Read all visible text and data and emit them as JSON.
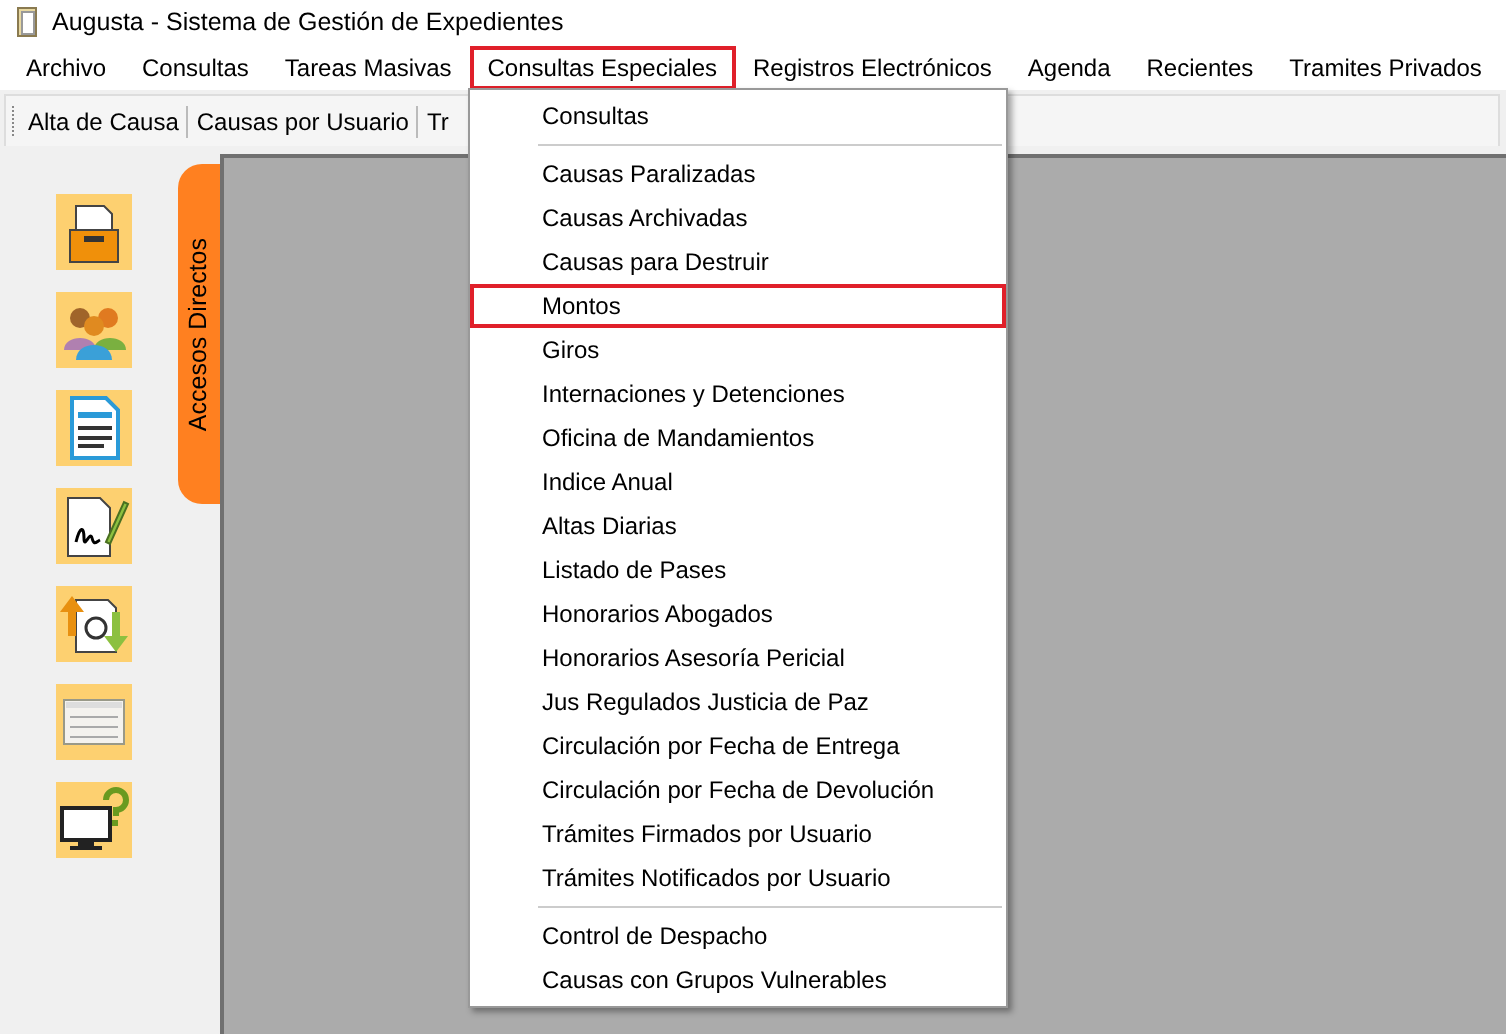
{
  "window": {
    "title": "Augusta - Sistema de Gestión de Expedientes"
  },
  "menubar": [
    {
      "label": "Archivo",
      "highlighted": false
    },
    {
      "label": "Consultas",
      "highlighted": false
    },
    {
      "label": "Tareas Masivas",
      "highlighted": false
    },
    {
      "label": "Consultas Especiales",
      "highlighted": true
    },
    {
      "label": "Registros Electrónicos",
      "highlighted": false
    },
    {
      "label": "Agenda",
      "highlighted": false
    },
    {
      "label": "Recientes",
      "highlighted": false
    },
    {
      "label": "Tramites Privados",
      "highlighted": false
    }
  ],
  "toolbar": [
    "Alta de Causa",
    "Causas por Usuario",
    "Tr"
  ],
  "side_tab": "Accesos Directos",
  "menu": {
    "groups": [
      [
        {
          "label": "Consultas",
          "highlighted": false
        }
      ],
      [
        {
          "label": "Causas Paralizadas",
          "highlighted": false
        },
        {
          "label": "Causas Archivadas",
          "highlighted": false
        },
        {
          "label": "Causas para Destruir",
          "highlighted": false
        },
        {
          "label": "Montos",
          "highlighted": true
        },
        {
          "label": "Giros",
          "highlighted": false
        },
        {
          "label": "Internaciones y Detenciones",
          "highlighted": false
        },
        {
          "label": "Oficina de Mandamientos",
          "highlighted": false
        },
        {
          "label": "Indice Anual",
          "highlighted": false
        },
        {
          "label": "Altas Diarias",
          "highlighted": false
        },
        {
          "label": "Listado de Pases",
          "highlighted": false
        },
        {
          "label": "Honorarios Abogados",
          "highlighted": false
        },
        {
          "label": "Honorarios Asesoría Pericial",
          "highlighted": false
        },
        {
          "label": "Jus Regulados Justicia de Paz",
          "highlighted": false
        },
        {
          "label": "Circulación por Fecha de Entrega",
          "highlighted": false
        },
        {
          "label": "Circulación por Fecha de Devolución",
          "highlighted": false
        },
        {
          "label": "Trámites Firmados por Usuario",
          "highlighted": false
        },
        {
          "label": "Trámites Notificados por Usuario",
          "highlighted": false
        }
      ],
      [
        {
          "label": "Control de Despacho",
          "highlighted": false
        },
        {
          "label": "Causas con Grupos Vulnerables",
          "highlighted": false
        }
      ]
    ]
  }
}
